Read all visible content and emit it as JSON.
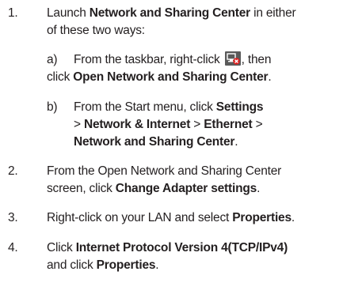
{
  "steps": [
    {
      "num": "1.",
      "line1_pre": "Launch ",
      "line1_bold": "Network and Sharing Center",
      "line1_post": " in either",
      "line2": "of these two ways:",
      "subs": [
        {
          "label": "a)",
          "line1_pre": "From the taskbar, right-click ",
          "icon": "network-error-tray-icon",
          "line1_post": ", then",
          "line2_pre": "click ",
          "line2_bold": "Open Network and Sharing Center",
          "line2_post": "."
        },
        {
          "label": "b)",
          "line1_pre": "From the Start menu, click ",
          "line1_bold": "Settings",
          "line2_pre": "> ",
          "line2_bold1": "Network & Internet",
          "line2_mid": " > ",
          "line2_bold2": "Ethernet",
          "line2_post": " >",
          "line3_bold": "Network and Sharing Center",
          "line3_post": "."
        }
      ]
    },
    {
      "num": "2.",
      "line1": "From the Open Network and Sharing Center",
      "line2_pre": "screen, click ",
      "line2_bold": "Change Adapter settings",
      "line2_post": "."
    },
    {
      "num": "3.",
      "line1_pre": "Right-click on your LAN and select ",
      "line1_bold": "Properties",
      "line1_post": "."
    },
    {
      "num": "4.",
      "line1_pre": "Click ",
      "line1_bold": "Internet Protocol Version 4(TCP/IPv4)",
      "line2_pre": "and click ",
      "line2_bold": "Properties",
      "line2_post": "."
    }
  ],
  "colors": {
    "text": "#231f20",
    "icon_bg": "#5a5a5a",
    "icon_badge": "#e02020"
  }
}
